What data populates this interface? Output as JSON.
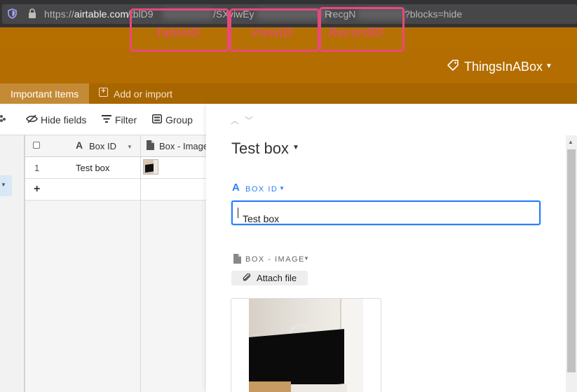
{
  "browser": {
    "url_prefix": "https://",
    "url_host": "airtable.com",
    "url_seg_table": "/tblD9",
    "url_seg_view": "/SX",
    "url_seg_view_id": "viwEy",
    "url_seg_record": "R",
    "url_seg_record_id": "recgN",
    "url_suffix": "?blocks=hide"
  },
  "annotations": {
    "table_id": "TableID",
    "view_id": "ViewID",
    "record_id": "RecordID",
    "color": "#e8497a"
  },
  "app": {
    "base_name": "ThingsInABox",
    "header_color": "#b56f00",
    "tabs": [
      {
        "label": "Important Items"
      }
    ],
    "add_or_import": "Add or import"
  },
  "toolbar": {
    "hide_fields": "Hide fields",
    "filter": "Filter",
    "group": "Group"
  },
  "grid": {
    "columns": [
      {
        "label": "Box ID",
        "icon": "text-field-icon"
      },
      {
        "label": "Box - Image",
        "icon": "attachment-field-icon"
      }
    ],
    "rows": [
      {
        "number": "1",
        "box_id": "Test box"
      }
    ],
    "add_row": "+"
  },
  "record": {
    "title": "Test box",
    "fields": {
      "box_id": {
        "label": "BOX ID",
        "value": "Test box",
        "color": "#2d7ff9"
      },
      "box_image": {
        "label": "BOX - IMAGE",
        "attach_label": "Attach file"
      }
    }
  }
}
